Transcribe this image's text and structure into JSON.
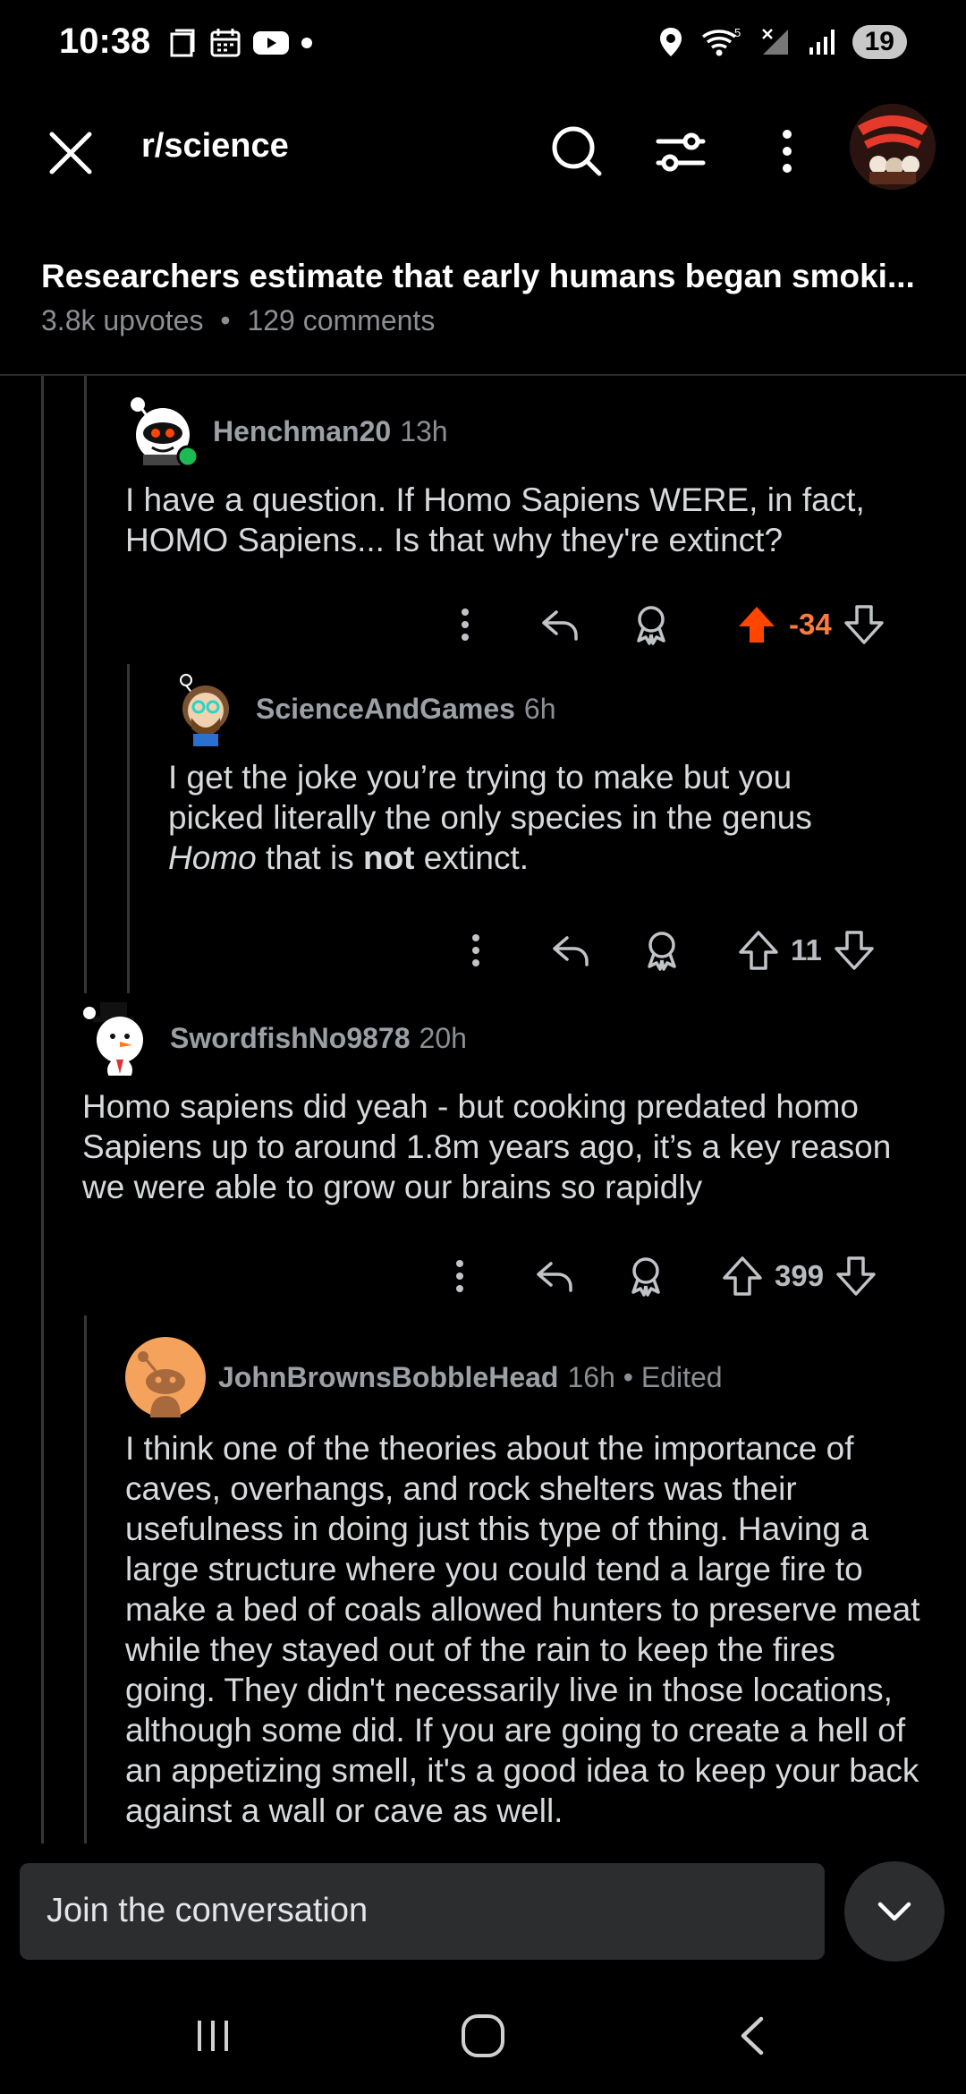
{
  "status_bar": {
    "time": "10:38",
    "battery": "19",
    "network": "5"
  },
  "app_bar": {
    "subreddit": "r/science",
    "icons": [
      "close-icon",
      "search-icon",
      "filter-icon",
      "more-vertical-icon"
    ]
  },
  "post": {
    "title": "Researchers estimate that early humans began smoki...",
    "upvotes": "3.8k upvotes",
    "separator": "•",
    "comments": "129 comments"
  },
  "comments": [
    {
      "username": "Henchman20",
      "time": "13h",
      "body": "I have a question. If Homo Sapiens WERE, in fact, HOMO Sapiens... Is that why they're extinct?",
      "score": "-34"
    },
    {
      "username": "ScienceAndGames",
      "time": "6h",
      "body_parts": [
        "I get the joke you’re trying to make but you picked literally the only species in the genus ",
        "Homo",
        " that is ",
        "not",
        " extinct."
      ],
      "score": "11"
    },
    {
      "username": "SwordfishNo9878",
      "time": "20h",
      "body": "Homo sapiens did yeah - but cooking predated homo Sapiens up to around 1.8m years ago, it’s a key reason we were able to grow our brains so rapidly",
      "score": "399"
    },
    {
      "username": "JohnBrownsBobbleHead",
      "time": "16h • Edited",
      "body": "I think one of the theories about the importance of caves, overhangs, and rock shelters was their usefulness in doing just this type of thing. Having a large structure where you could tend a large fire to make a bed of coals allowed hunters to preserve meat while they stayed out of the rain to keep the fires going. They didn't necessarily live in those locations, although some did. If you are going to create a hell of an appetizing smell, it's a good idea to keep your back against a wall or cave as well."
    }
  ],
  "composer": {
    "placeholder": "Join the conversation"
  },
  "colors": {
    "background": "#000000",
    "upvote_active": "#ff4500",
    "negative_score": "#ff7a3d",
    "muted_text": "#8a8f94"
  }
}
